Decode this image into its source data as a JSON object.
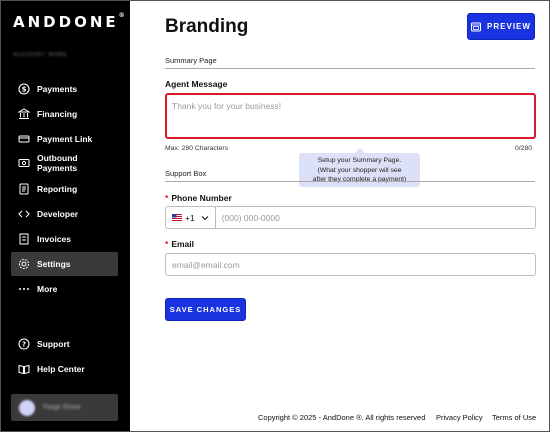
{
  "sidebar": {
    "logo": "ANDDONE",
    "logo_mark": "®",
    "account_name": "ACCOUNT NAME",
    "items": [
      {
        "label": "Payments",
        "icon": "dollar-circle-icon"
      },
      {
        "label": "Financing",
        "icon": "bank-icon"
      },
      {
        "label": "Payment Link",
        "icon": "link-icon"
      },
      {
        "label": "Outbound Payments",
        "icon": "outbound-icon"
      },
      {
        "label": "Reporting",
        "icon": "report-icon"
      },
      {
        "label": "Developer",
        "icon": "code-icon"
      },
      {
        "label": "Invoices",
        "icon": "invoice-icon"
      },
      {
        "label": "Settings",
        "icon": "gear-icon",
        "active": true
      },
      {
        "label": "More",
        "icon": "more-dots-icon"
      }
    ],
    "bottom_items": [
      {
        "label": "Support",
        "icon": "help-circle-icon"
      },
      {
        "label": "Help Center",
        "icon": "book-icon"
      }
    ],
    "user_name": "Paige Roxie"
  },
  "header": {
    "title": "Branding",
    "preview_label": "PREVIEW"
  },
  "summary_page": {
    "section_label": "Summary Page",
    "agent_message_label": "Agent Message",
    "agent_message_placeholder": "Thank you for your business!",
    "max_hint": "Max: 280 Characters",
    "char_count": "0/280",
    "tooltip_line1": "Setup your Summary Page.",
    "tooltip_line2": "(What your shopper will see",
    "tooltip_line3": "after they complete a payment)"
  },
  "support_box": {
    "section_label": "Support Box",
    "phone_label": "Phone Number",
    "required_mark": "*",
    "country_code": "+1",
    "phone_placeholder": "(000) 000-0000",
    "email_label": "Email",
    "email_placeholder": "email@email.com"
  },
  "actions": {
    "save_label": "SAVE CHANGES"
  },
  "footer": {
    "copyright": "Copyright © 2025 - AndDone ®. All rights reserved",
    "privacy": "Privacy Policy",
    "terms": "Terms of Use"
  },
  "colors": {
    "sidebar_bg": "#000000",
    "accent": "#1a33e0",
    "error_border": "#d81a26",
    "tooltip_bg": "#dde1f8"
  }
}
